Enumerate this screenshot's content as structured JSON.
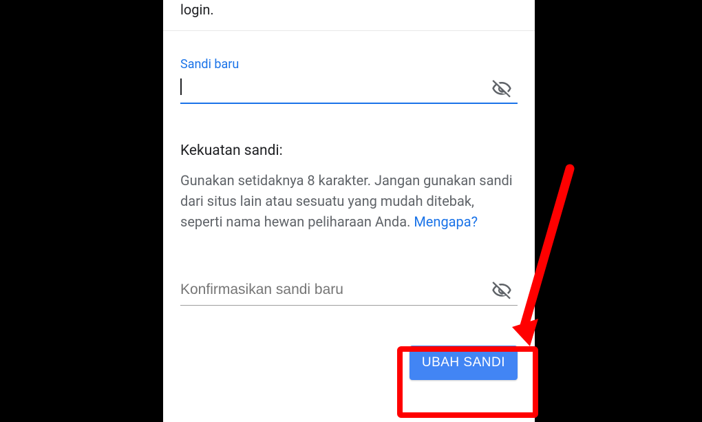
{
  "intro_tail": "login.",
  "field_new": {
    "label": "Sandi baru"
  },
  "strength": {
    "title": "Kekuatan sandi:",
    "help": "Gunakan setidaknya 8 karakter. Jangan gunakan sandi dari situs lain atau sesuatu yang mudah ditebak, seperti nama hewan peliharaan Anda. ",
    "why_link": "Mengapa?"
  },
  "field_confirm": {
    "placeholder": "Konfirmasikan sandi baru"
  },
  "submit_label": "UBAH SANDI"
}
